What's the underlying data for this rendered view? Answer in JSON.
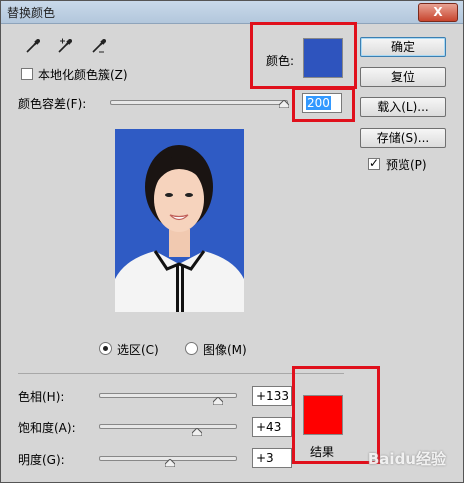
{
  "window": {
    "title": "替换颜色",
    "close_label": "X"
  },
  "tools": [
    {
      "icon": "eyedropper-icon"
    },
    {
      "icon": "eyedropper-plus-icon"
    },
    {
      "icon": "eyedropper-minus-icon"
    }
  ],
  "localized_clusters": {
    "label": "本地化颜色簇(Z)",
    "checked": false
  },
  "color": {
    "label": "颜色:",
    "value": "#2e54be"
  },
  "fuzziness": {
    "label": "颜色容差(F):",
    "value": "200",
    "level_fraction": 1.0
  },
  "buttons": {
    "ok": "确定",
    "reset": "复位",
    "load": "载入(L)...",
    "save": "存储(S)..."
  },
  "preview": {
    "label": "预览(P)",
    "checked": true
  },
  "view_mode": {
    "selection_label": "选区(C)",
    "image_label": "图像(M)",
    "selected": "selection"
  },
  "replacement": {
    "hue": {
      "label": "色相(H):",
      "value": "+133",
      "min": -180,
      "max": 180
    },
    "saturation": {
      "label": "饱和度(A):",
      "value": "+43",
      "min": -100,
      "max": 100
    },
    "lightness": {
      "label": "明度(G):",
      "value": "+3",
      "min": -100,
      "max": 100
    }
  },
  "result": {
    "label": "结果",
    "color": "#ff0000"
  },
  "watermark": "Baidu经验",
  "colors": {
    "highlight_red": "#e0101c",
    "photo_background": "#2f5bc4"
  }
}
